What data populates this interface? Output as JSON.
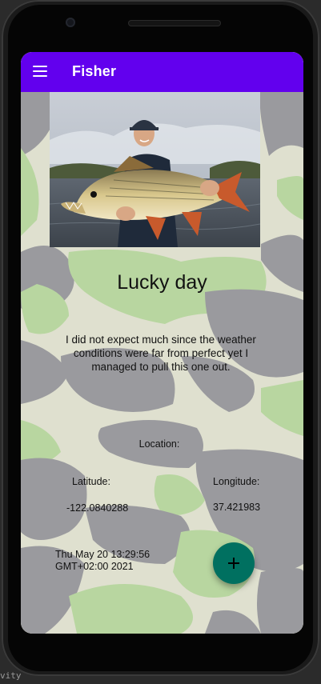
{
  "app_bar": {
    "title": "Fisher",
    "menu_icon": "hamburger-menu-icon",
    "color": "#6200ee"
  },
  "catch": {
    "title": "Lucky day",
    "description": "I did not expect much since the weather conditions were far from perfect yet I managed to pull this one out.",
    "location_label": "Location:",
    "latitude_label": "Latitude:",
    "longitude_label": "Longitude:",
    "latitude_value": "-122.0840288",
    "longitude_value": "37.421983",
    "date": "Thu May 20 13:29:56 GMT+02:00 2021"
  },
  "fab": {
    "icon": "plus-icon",
    "color": "#007060"
  },
  "background_text": "vity"
}
